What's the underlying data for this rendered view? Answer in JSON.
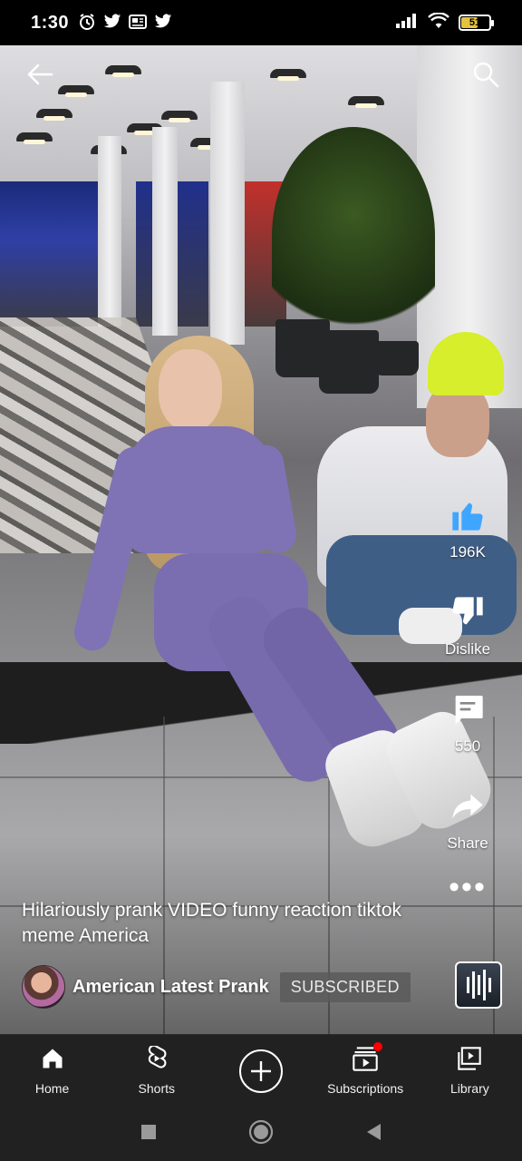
{
  "status_bar": {
    "time": "1:30",
    "battery": "51",
    "icons": [
      "alarm-icon",
      "twitter-icon",
      "news-icon",
      "twitter-icon",
      "signal-icon",
      "wifi-icon",
      "battery-icon"
    ]
  },
  "top_bar": {
    "back_icon": "back-arrow-icon",
    "search_icon": "search-icon"
  },
  "actions": {
    "like_count": "196K",
    "dislike_label": "Dislike",
    "comment_count": "550",
    "share_label": "Share",
    "more_label": "•••"
  },
  "video": {
    "caption": "Hilariously prank VIDEO funny reaction tiktok meme America",
    "channel_name": "American Latest Prank",
    "subscribe_state": "SUBSCRIBED"
  },
  "bottom_nav": {
    "items": [
      {
        "label": "Home",
        "icon": "home-icon"
      },
      {
        "label": "Shorts",
        "icon": "shorts-icon"
      },
      {
        "label": "",
        "icon": "create-plus-icon"
      },
      {
        "label": "Subscriptions",
        "icon": "subscriptions-icon"
      },
      {
        "label": "Library",
        "icon": "library-icon"
      }
    ]
  },
  "colors": {
    "like_accent": "#3ea6ff",
    "notification_dot": "#ff0000",
    "nav_bg": "#212121"
  }
}
